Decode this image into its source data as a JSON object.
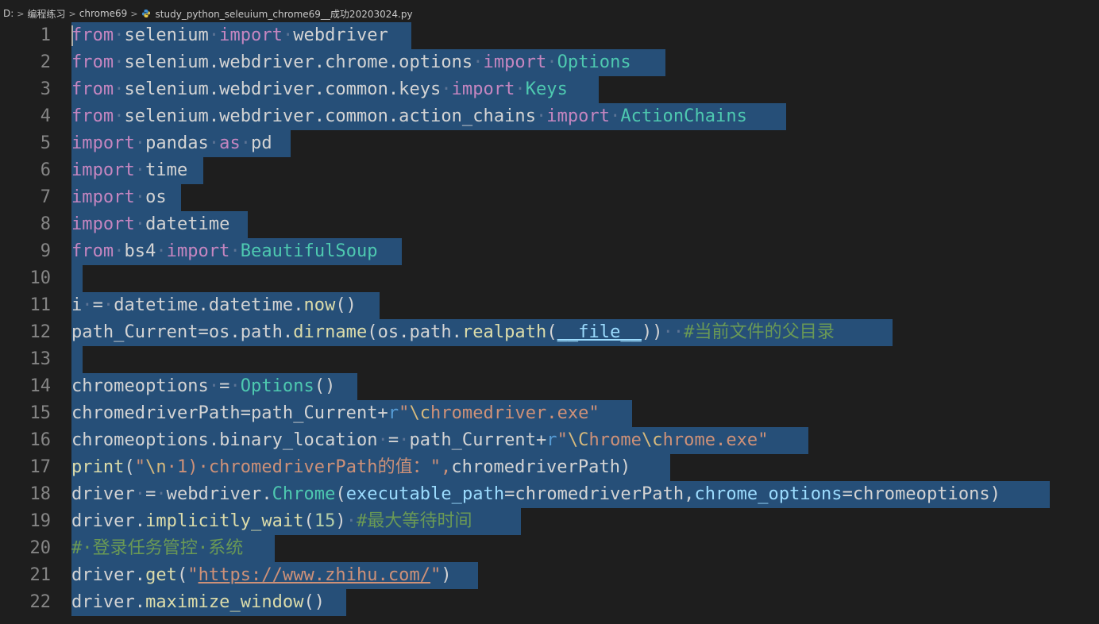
{
  "breadcrumb": {
    "drive": "D:",
    "folder1": "编程练习",
    "folder2": "chrome69",
    "file": "study_python_seleuium_chrome69__成功20203024.py",
    "file_icon": "python-file-icon"
  },
  "editor": {
    "line_numbers": [
      "1",
      "2",
      "3",
      "4",
      "5",
      "6",
      "7",
      "8",
      "9",
      "10",
      "11",
      "12",
      "13",
      "14",
      "15",
      "16",
      "17",
      "18",
      "19",
      "20",
      "21",
      "22"
    ],
    "lines": [
      "from selenium import webdriver",
      "from selenium.webdriver.chrome.options import Options",
      "from selenium.webdriver.common.keys import Keys",
      "from selenium.webdriver.common.action_chains import ActionChains",
      "import pandas as pd",
      "import time",
      "import os",
      "import datetime",
      "from bs4 import BeautifulSoup",
      "",
      "i = datetime.datetime.now()",
      "path_Current=os.path.dirname(os.path.realpath(__file__))  #当前文件的父目录",
      "",
      "chromeoptions = Options()",
      "chromedriverPath=path_Current+r\"\\chromedriver.exe\"",
      "chromeoptions.binary_location = path_Current+r\"\\Chrome\\chrome.exe\"",
      "print(\"\\n 1) chromedriverPath的值：\",chromedriverPath)",
      "driver = webdriver.Chrome(executable_path=chromedriverPath,chrome_options=chromeoptions)",
      "driver.implicitly_wait(15) #最大等待时间",
      "# 登录任务管控 系统",
      "driver.get(\"https://www.zhihu.com/\")",
      "driver.maximize_window()"
    ]
  },
  "colors": {
    "background": "#1e1e1e",
    "selection": "#264f78",
    "keyword": "#c586c0",
    "string": "#ce9178",
    "comment": "#6a9955",
    "function": "#dcdcaa",
    "class": "#4ec9b0",
    "parameter": "#9cdcfe",
    "number": "#b5cea8"
  }
}
